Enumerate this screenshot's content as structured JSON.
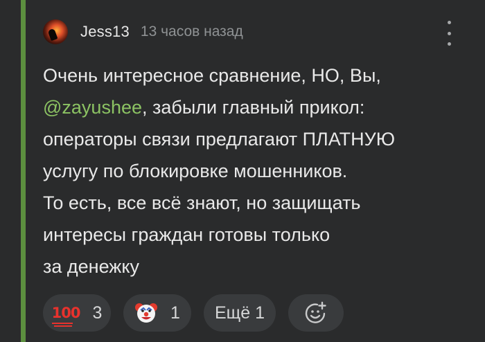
{
  "comment": {
    "author": "Jess13",
    "time": "13 часов назад",
    "text": {
      "line1": "Очень интересное сравнение, НО, Вы,",
      "mention": "@zayushee",
      "line2_rest": ", забыли главный прикол:",
      "line3": "операторы связи предлагают ПЛАТНУЮ",
      "line4": "услугу по блокировке мошенников.",
      "line5": "То есть, все всё знают, но защищать",
      "line6": "интересы граждан готовы только",
      "line7": "за денежку"
    }
  },
  "reactions": [
    {
      "icon": "hundred-points-emoji",
      "count": "3"
    },
    {
      "icon": "clown-face-emoji",
      "count": "1"
    }
  ],
  "more_reactions_label": "Ещё 1",
  "colors": {
    "background": "#2a2b2c",
    "thread_line": "#5c8f3f",
    "mention": "#8cc363",
    "pill": "#393b3d"
  }
}
